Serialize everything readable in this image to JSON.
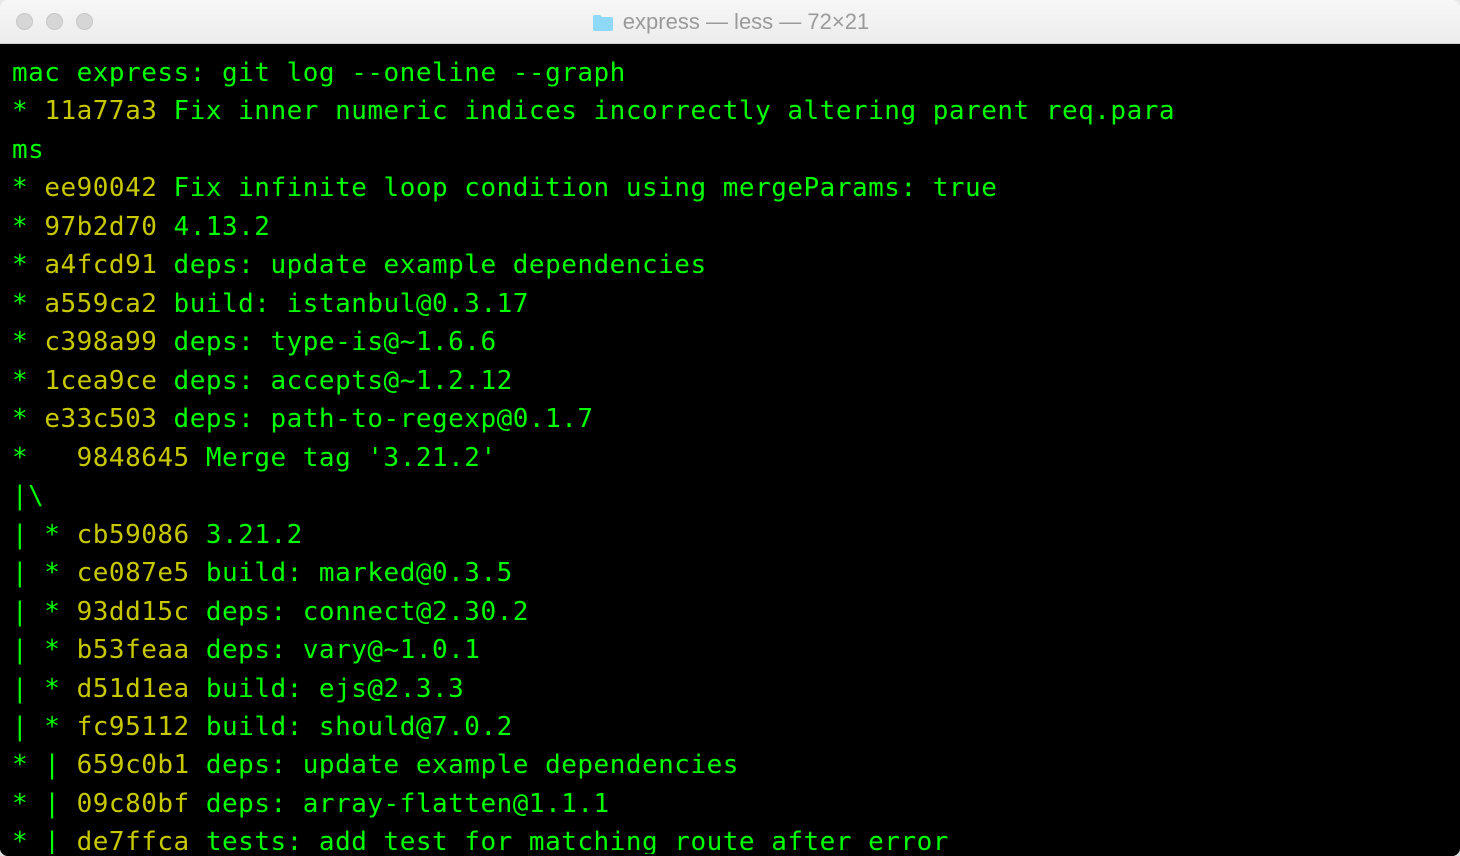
{
  "window": {
    "title": "express — less — 72×21"
  },
  "terminal": {
    "prompt": "mac express: ",
    "command": "git log --oneline --graph",
    "log": [
      {
        "graph": "* ",
        "hash": "11a77a3",
        "msg": " Fix inner numeric indices incorrectly altering parent req.params"
      },
      {
        "graph": "* ",
        "hash": "ee90042",
        "msg": " Fix infinite loop condition using mergeParams: true"
      },
      {
        "graph": "* ",
        "hash": "97b2d70",
        "msg": " 4.13.2"
      },
      {
        "graph": "* ",
        "hash": "a4fcd91",
        "msg": " deps: update example dependencies"
      },
      {
        "graph": "* ",
        "hash": "a559ca2",
        "msg": " build: istanbul@0.3.17"
      },
      {
        "graph": "* ",
        "hash": "c398a99",
        "msg": " deps: type-is@~1.6.6"
      },
      {
        "graph": "* ",
        "hash": "1cea9ce",
        "msg": " deps: accepts@~1.2.12"
      },
      {
        "graph": "* ",
        "hash": "e33c503",
        "msg": " deps: path-to-regexp@0.1.7"
      },
      {
        "graph": "*   ",
        "hash": "9848645",
        "msg": " Merge tag '3.21.2'"
      },
      {
        "graph": "|\\  ",
        "hash": "",
        "msg": ""
      },
      {
        "graph": "| * ",
        "hash": "cb59086",
        "msg": " 3.21.2"
      },
      {
        "graph": "| * ",
        "hash": "ce087e5",
        "msg": " build: marked@0.3.5"
      },
      {
        "graph": "| * ",
        "hash": "93dd15c",
        "msg": " deps: connect@2.30.2"
      },
      {
        "graph": "| * ",
        "hash": "b53feaa",
        "msg": " deps: vary@~1.0.1"
      },
      {
        "graph": "| * ",
        "hash": "d51d1ea",
        "msg": " build: ejs@2.3.3"
      },
      {
        "graph": "| * ",
        "hash": "fc95112",
        "msg": " build: should@7.0.2"
      },
      {
        "graph": "* | ",
        "hash": "659c0b1",
        "msg": " deps: update example dependencies"
      },
      {
        "graph": "* | ",
        "hash": "09c80bf",
        "msg": " deps: array-flatten@1.1.1"
      },
      {
        "graph": "* | ",
        "hash": "de7ffca",
        "msg": " tests: add test for matching route after error"
      }
    ]
  }
}
